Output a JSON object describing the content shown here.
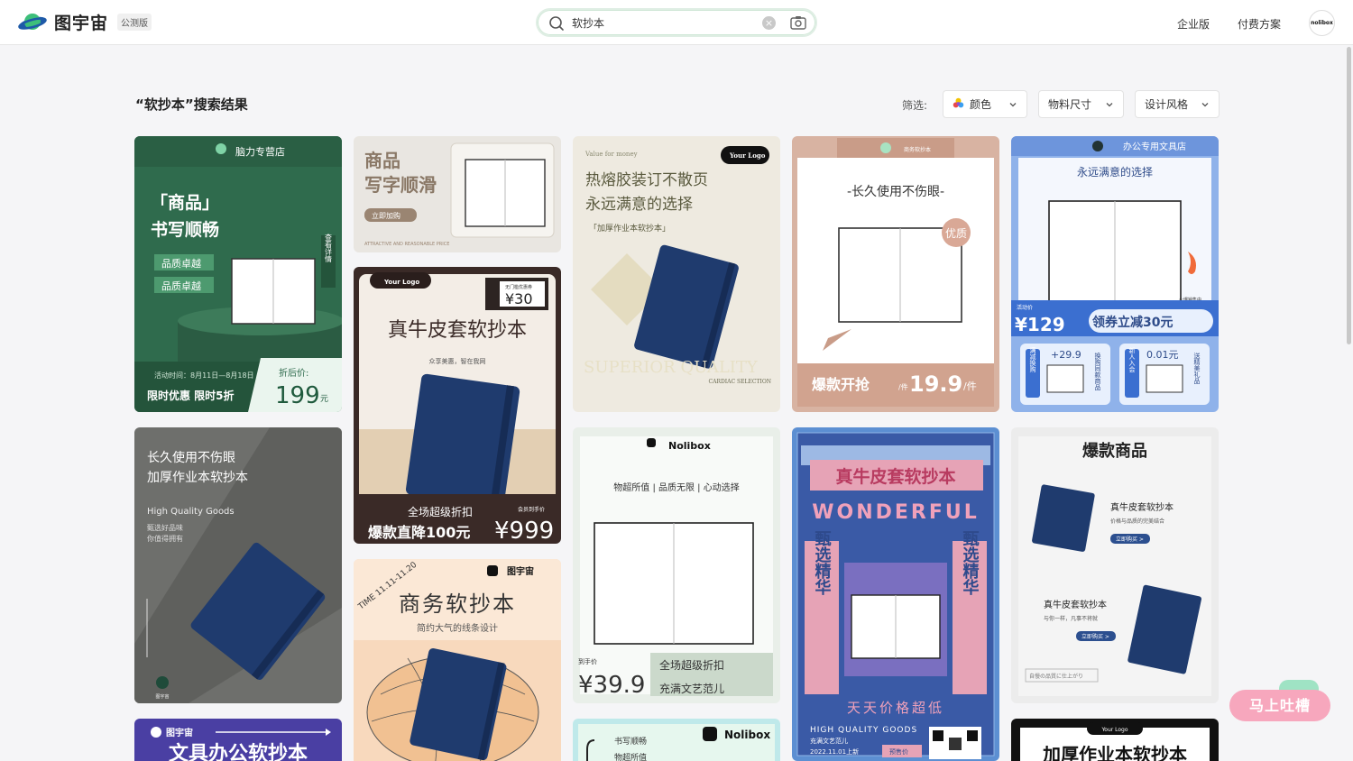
{
  "brand": {
    "name": "图宇宙",
    "badge": "公测版"
  },
  "search": {
    "value": "软抄本"
  },
  "nav": {
    "enterprise": "企业版",
    "pricing": "付费方案",
    "avatar_text": "nolibox"
  },
  "results": {
    "title": "“软抄本”搜索结果"
  },
  "filters": {
    "label": "筛选:",
    "color": "颜色",
    "size": "物料尺寸",
    "style": "设计风格"
  },
  "feedback": {
    "label": "马上吐槽"
  },
  "cards": {
    "c1": {
      "store": "脑力专营店",
      "line1": "「商品」",
      "line2": "书写顺畅",
      "tag1": "品质卓越",
      "tag2": "品质卓越",
      "side": "查看详情",
      "date": "活动时间：8月11日—8月18日",
      "promo": "限时优惠 限时5折",
      "price_label": "折后价:",
      "price": "199",
      "unit": "元"
    },
    "c2": {
      "line1": "商品",
      "line2": "写字顺滑",
      "btn": "立即加购",
      "foot": "ATTRACTIVE AND REASONABLE PRICE"
    },
    "c3": {
      "logo": "Your Logo",
      "coupon": "无门槛优惠券",
      "coupon_price": "¥30",
      "title": "真牛皮套软抄本",
      "sub": "众享美惠，智在我网",
      "promo": "全场超级折扣",
      "price_tag": "会员到手价",
      "cut": "爆款直降100元",
      "price": "¥999"
    },
    "c4": {
      "top": "Value for money",
      "logo": "Your Logo",
      "line1": "热熔胶装订不散页",
      "line2": "永远满意的选择",
      "line3": "「加厚作业本软抄本」",
      "en": "SUPERIOR QUALITY",
      "en2": "CARDIAC SELECTION"
    },
    "c5": {
      "store": "商务软抄本",
      "title": "-长久使用不伤眼-",
      "badge": "优质",
      "promo": "爆款开抢",
      "per": "/件",
      "price": "19.9",
      "unit": "/件"
    },
    "c6": {
      "store": "办公专用文具店",
      "title": "永远满意的选择",
      "tag": "活动价",
      "price": "¥129",
      "coupon": "领券立减30元",
      "hot": "火爆销售中",
      "left_label": "满减换购",
      "left_price": "+29.9",
      "left_side": "换购同款商品",
      "right_label": "新人入会",
      "right_price": "0.01元",
      "right_side": "送精美礼品"
    },
    "c7": {
      "line1": "长久使用不伤眼",
      "line2": "加厚作业本软抄本",
      "en": "High Quality Goods",
      "sub1": "甄选好品味",
      "sub2": "你值得拥有",
      "logo": "图宇宙"
    },
    "c8": {
      "logo": "Nolibox",
      "slogan": "物超所值 | 品质无限 | 心动选择",
      "price_label": "到手价",
      "price": "¥39.9",
      "promo": "全场超级折扣",
      "sub": "充满文艺范儿"
    },
    "c9": {
      "title": "真牛皮套软抄本",
      "en": "WONDERFUL",
      "left": "甄选精华",
      "right": "甄选精华",
      "bottom": "天天价格超低",
      "en2": "HIGH QUALITY GOODS",
      "sub": "充满文艺范儿",
      "date": "2022.11.01上新",
      "presale": "预售价"
    },
    "c10": {
      "title": "爆款商品",
      "p1": "真牛皮套软抄本",
      "p1s": "价格与品质的完美结合",
      "btn": "立即购买 >",
      "p2": "真牛皮套软抄本",
      "p2s": "与你一样，凡事不将就",
      "foot": "自慢の品質に仕上がり"
    },
    "c11": {
      "logo": "图宇宙",
      "title": "文具办公软抄本"
    },
    "c12": {
      "time": "TIME 11.11-11.20",
      "logo": "图宇宙",
      "title": "商务软抄本",
      "sub": "简约大气的线条设计"
    },
    "c13": {
      "logo": "Nolibox",
      "l1": "书写顺畅",
      "l2": "物超所值"
    },
    "c14": {
      "logo": "Your Logo",
      "title": "加厚作业本软抄本"
    }
  },
  "colors": {
    "accent": "#2e9e5b",
    "navy": "#1f3b6e"
  }
}
